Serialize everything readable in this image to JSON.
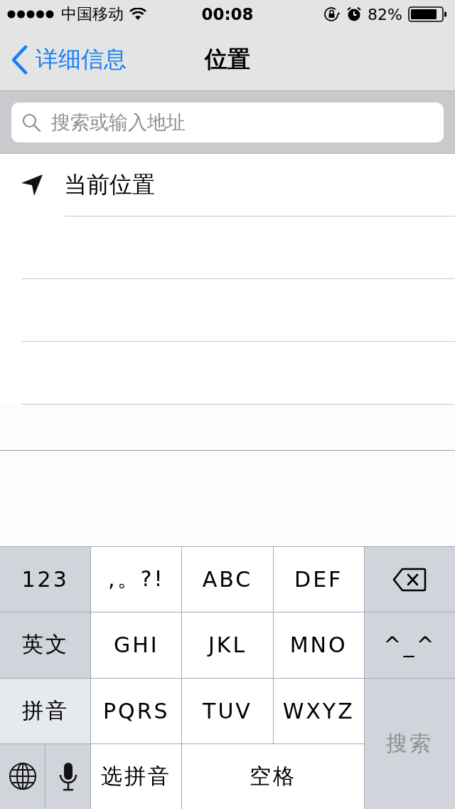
{
  "status_bar": {
    "carrier": "中国移动",
    "time": "00:08",
    "battery": "82%"
  },
  "nav": {
    "back": "详细信息",
    "title": "位置"
  },
  "search": {
    "placeholder": "搜索或输入地址"
  },
  "list": [
    {
      "label": "当前位置"
    }
  ],
  "keyboard": [
    {
      "kind": "function",
      "label": "123",
      "selected": false,
      "disabled": false
    },
    {
      "kind": "letter",
      "label": ",。?!",
      "selected": false,
      "disabled": false
    },
    {
      "kind": "letter",
      "label": "ABC",
      "selected": false,
      "disabled": false
    },
    {
      "kind": "letter",
      "label": "DEF",
      "selected": false,
      "disabled": false
    },
    {
      "kind": "delete",
      "selected": false,
      "disabled": false
    },
    {
      "kind": "function",
      "label": "英文",
      "selected": false,
      "disabled": false
    },
    {
      "kind": "letter",
      "label": "GHI",
      "selected": false,
      "disabled": false
    },
    {
      "kind": "letter",
      "label": "JKL",
      "selected": false,
      "disabled": false
    },
    {
      "kind": "letter",
      "label": "MNO",
      "selected": false,
      "disabled": false
    },
    {
      "kind": "function",
      "label": "^_^",
      "selected": false,
      "disabled": false
    },
    {
      "kind": "function",
      "label": "拼音",
      "selected": true,
      "disabled": false
    },
    {
      "kind": "letter",
      "label": "PQRS",
      "selected": false,
      "disabled": false
    },
    {
      "kind": "letter",
      "label": "TUV",
      "selected": false,
      "disabled": false
    },
    {
      "kind": "letter",
      "label": "WXYZ",
      "selected": false,
      "disabled": false
    },
    {
      "kind": "return",
      "label": "搜索",
      "selected": false,
      "disabled": true
    },
    {
      "kind": "globe",
      "selected": false,
      "disabled": false
    },
    {
      "kind": "mic",
      "selected": false,
      "disabled": false
    },
    {
      "kind": "letter",
      "label": "选拼音",
      "selected": false,
      "disabled": false
    },
    {
      "kind": "space",
      "label": "空格",
      "selected": false,
      "disabled": false
    }
  ]
}
